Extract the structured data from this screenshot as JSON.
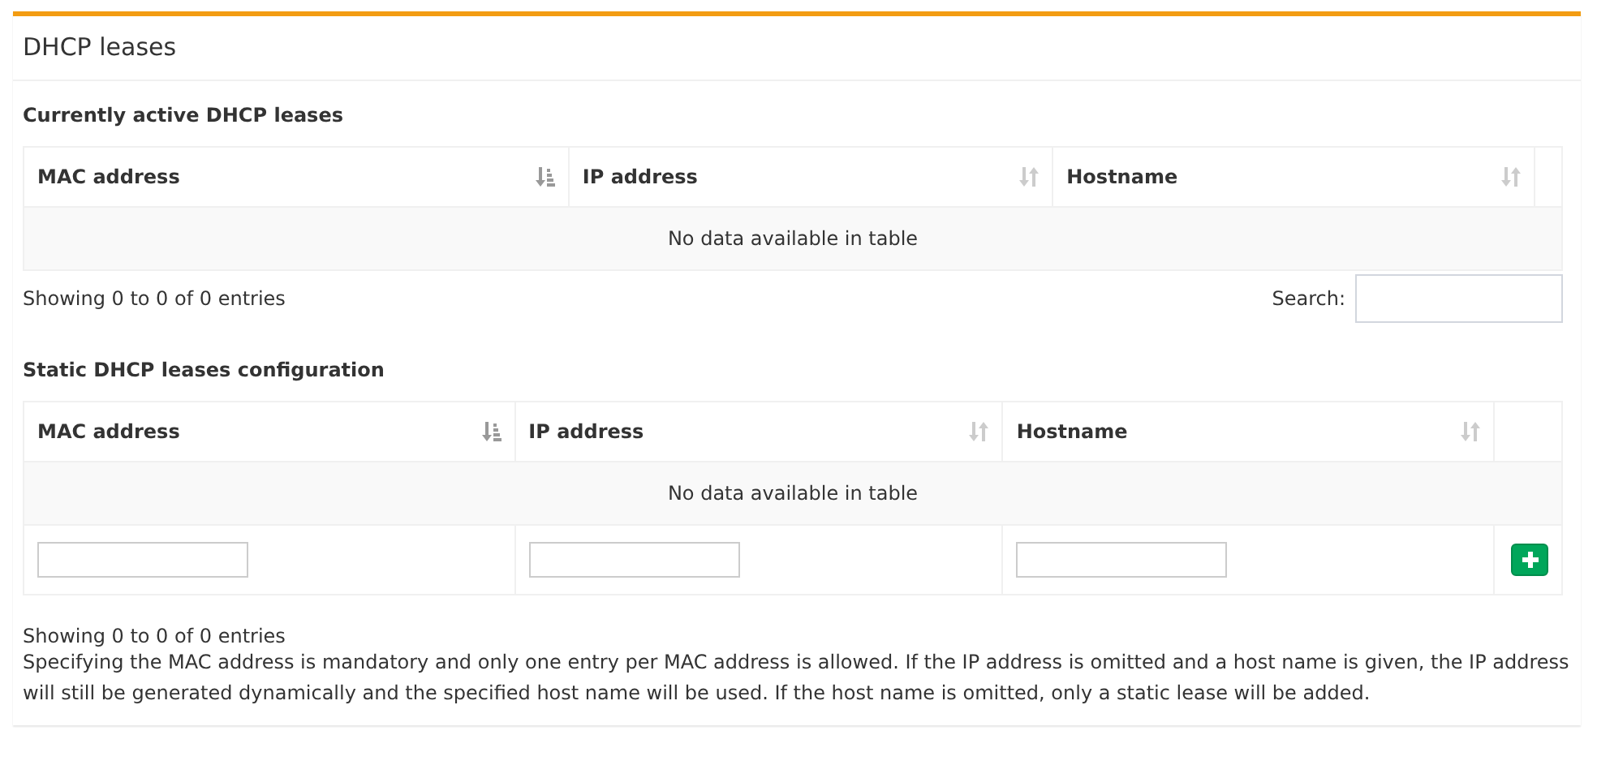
{
  "panel": {
    "title": "DHCP leases"
  },
  "active_leases": {
    "heading": "Currently active DHCP leases",
    "columns": [
      {
        "label": "MAC address",
        "sorted": true
      },
      {
        "label": "IP address",
        "sorted": false
      },
      {
        "label": "Hostname",
        "sorted": false
      }
    ],
    "empty_message": "No data available in table",
    "info": "Showing 0 to 0 of 0 entries",
    "search_label": "Search:"
  },
  "static_leases": {
    "heading": "Static DHCP leases configuration",
    "columns": [
      {
        "label": "MAC address",
        "sorted": true
      },
      {
        "label": "IP address",
        "sorted": false
      },
      {
        "label": "Hostname",
        "sorted": false
      }
    ],
    "empty_message": "No data available in table",
    "info": "Showing 0 to 0 of 0 entries",
    "note": "Specifying the MAC address is mandatory and only one entry per MAC address is allowed. If the IP address is omitted and a host name is given, the IP address will still be generated dynamically and the specified host name will be used. If the host name is omitted, only a static lease will be added."
  }
}
